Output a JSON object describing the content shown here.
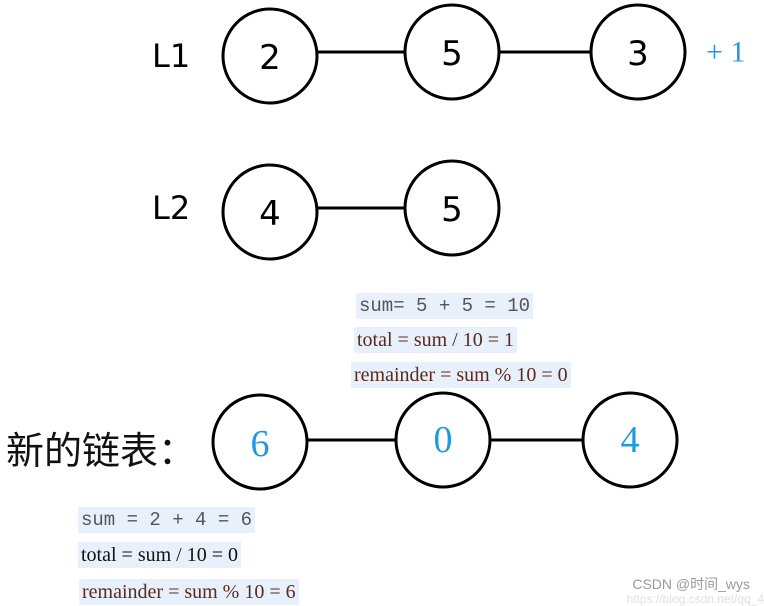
{
  "lists": {
    "l1": {
      "label": "L1",
      "nodes": [
        "2",
        "5",
        "3"
      ],
      "carry": "+ 1"
    },
    "l2": {
      "label": "L2",
      "nodes": [
        "4",
        "5"
      ]
    },
    "result": {
      "label": "新的链表：",
      "nodes": [
        "6",
        "0",
        "4"
      ]
    }
  },
  "calc_second": {
    "sum": "sum= 5 + 5 = 10",
    "total": "total = sum / 10 = 1",
    "remainder": "remainder = sum % 10 = 0"
  },
  "calc_first": {
    "sum": "sum = 2 + 4 = 6",
    "total": "total = sum / 10 = 0",
    "remainder": "remainder = sum % 10 = 6"
  },
  "colors": {
    "result_accent": "#1e9be0",
    "highlight": "#e8f0fb"
  },
  "watermark": {
    "text": "CSDN @时间_wys",
    "url_partial": "https://blog.csdn.net/qq_4"
  }
}
